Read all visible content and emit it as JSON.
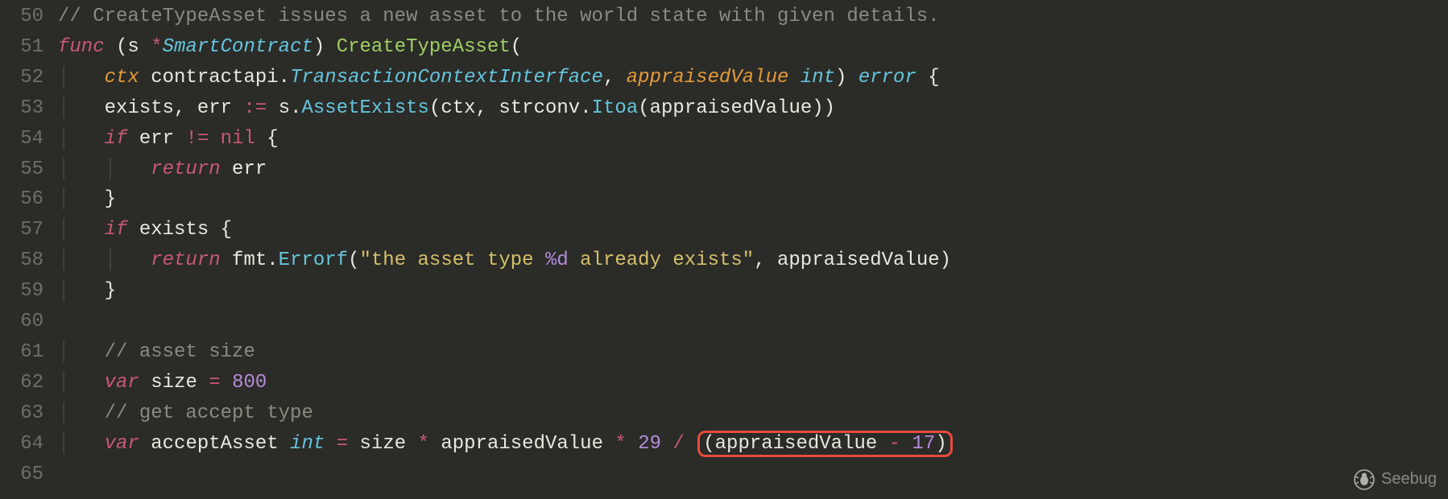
{
  "gutter": {
    "l50": "50",
    "l51": "51",
    "l52": "52",
    "l53": "53",
    "l54": "54",
    "l55": "55",
    "l56": "56",
    "l57": "57",
    "l58": "58",
    "l59": "59",
    "l60": "60",
    "l61": "61",
    "l62": "62",
    "l63": "63",
    "l64": "64",
    "l65": "65"
  },
  "code": {
    "l50": {
      "comment": "// CreateTypeAsset issues a new asset to the world state with given details."
    },
    "l51": {
      "kw_func": "func",
      "recv_open": "(",
      "recv_name": "s",
      "recv_star": "*",
      "recv_type": "SmartContract",
      "recv_close": ")",
      "fn_name": "CreateTypeAsset",
      "open_paren": "("
    },
    "l52": {
      "param1": "ctx",
      "pkg": "contractapi",
      "dot": ".",
      "iface": "TransactionContextInterface",
      "comma": ",",
      "param2": "appraisedValue",
      "ptype": "int",
      "close_paren": ")",
      "ret": "error",
      "brace": "{"
    },
    "l53": {
      "var1": "exists",
      "comma": ",",
      "var2": "err",
      "assign": ":=",
      "s": "s",
      "dot1": ".",
      "method": "AssetExists",
      "open": "(",
      "arg1": "ctx",
      "c1": ",",
      "pkg": "strconv",
      "dot2": ".",
      "fn": "Itoa",
      "o2": "(",
      "argv": "appraisedValue",
      "c2": "))"
    },
    "l54": {
      "kw": "if",
      "v": "err",
      "neq": "!=",
      "nil": "nil",
      "brace": "{"
    },
    "l55": {
      "kw": "return",
      "v": "err"
    },
    "l56": {
      "brace": "}"
    },
    "l57": {
      "kw": "if",
      "v": "exists",
      "brace": "{"
    },
    "l58": {
      "kw": "return",
      "pkg": "fmt",
      "dot": ".",
      "fn": "Errorf",
      "open": "(",
      "str1": "\"the asset type ",
      "fmt": "%d",
      "str2": " already exists\"",
      "comma": ",",
      "arg": "appraisedValue",
      "close": ")"
    },
    "l59": {
      "brace": "}"
    },
    "l61": {
      "comment": "// asset size"
    },
    "l62": {
      "kw": "var",
      "name": "size",
      "eq": "=",
      "val": "800"
    },
    "l63": {
      "comment": "// get accept type"
    },
    "l64": {
      "kw": "var",
      "name": "acceptAsset",
      "type": "int",
      "eq": "=",
      "t1": "size",
      "mul1": "*",
      "t2": "appraisedValue",
      "mul2": "*",
      "n29": "29",
      "div": "/",
      "open": "(",
      "t3": "appraisedValue",
      "minus": "-",
      "n17": "17",
      "close": ")"
    }
  },
  "watermark": {
    "text": "Seebug"
  },
  "chart_data": {
    "type": "table",
    "language": "go",
    "highlighted_expression": "(appraisedValue - 17)",
    "line_range": [
      50,
      65
    ],
    "source_lines": [
      "// CreateTypeAsset issues a new asset to the world state with given details.",
      "func (s *SmartContract) CreateTypeAsset(",
      "    ctx contractapi.TransactionContextInterface, appraisedValue int) error {",
      "    exists, err := s.AssetExists(ctx, strconv.Itoa(appraisedValue))",
      "    if err != nil {",
      "        return err",
      "    }",
      "    if exists {",
      "        return fmt.Errorf(\"the asset type %d already exists\", appraisedValue)",
      "    }",
      "",
      "    // asset size",
      "    var size = 800",
      "    // get accept type",
      "    var acceptAsset int = size * appraisedValue * 29 / (appraisedValue - 17)",
      ""
    ]
  }
}
